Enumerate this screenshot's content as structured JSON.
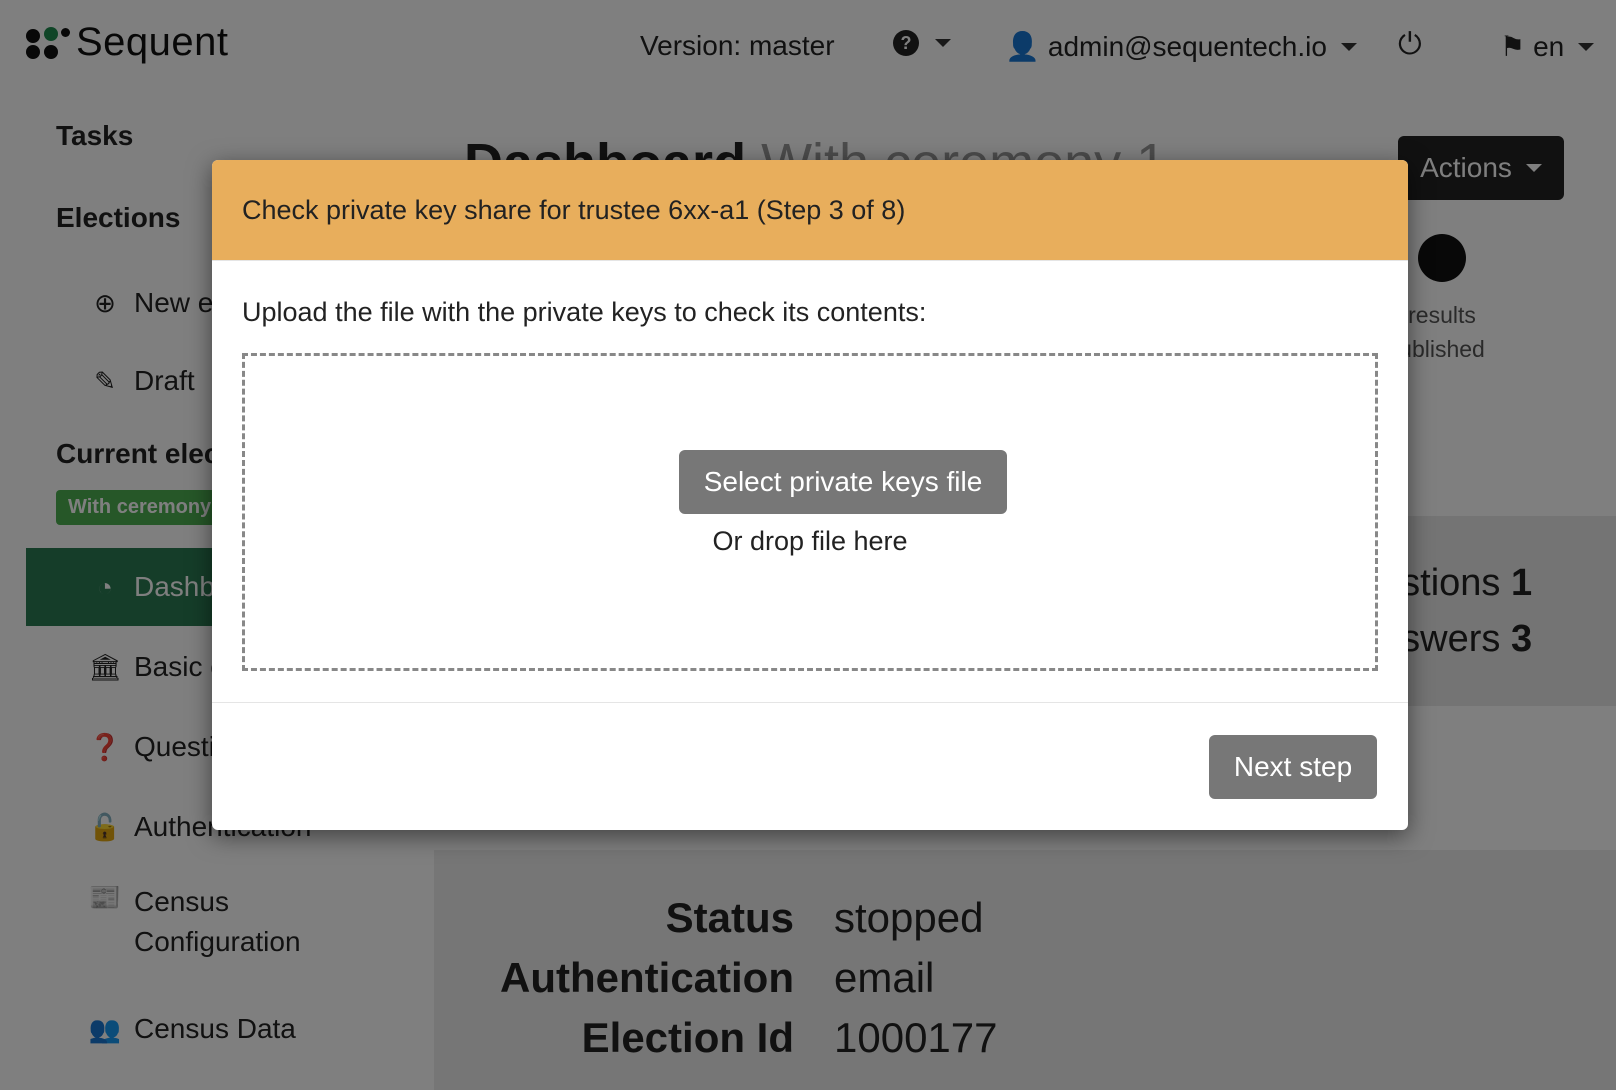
{
  "brand": {
    "name": "Sequent"
  },
  "topbar": {
    "version_text": "Version: master",
    "user_email": "admin@sequentech.io",
    "language": "en"
  },
  "sidebar": {
    "tasks_heading": "Tasks",
    "elections_heading": "Elections",
    "new_election": "New el",
    "draft": "Draft",
    "current_heading": "Current elec",
    "current_badge": "With ceremony",
    "items": [
      {
        "label": "Dashb",
        "icon": "dashboard-icon"
      },
      {
        "label": "Basic c",
        "icon": "bank-icon"
      },
      {
        "label": "Questi",
        "icon": "question-icon"
      },
      {
        "label": "Authentication",
        "icon": "unlock-icon"
      },
      {
        "label": "Census Configuration",
        "icon": "newspaper-icon"
      },
      {
        "label": "Census Data",
        "icon": "users-icon"
      }
    ]
  },
  "main": {
    "title": "Dashboard",
    "title_muted": "With ceremony 1",
    "actions_label": "Actions",
    "step_label_1": "results",
    "step_label_2": "ublished",
    "stats": {
      "questions_label": "estions",
      "questions_value": "1",
      "answers_label": "nswers",
      "answers_value": "3"
    },
    "info": [
      {
        "key": "Status",
        "value": "stopped"
      },
      {
        "key": "Authentication",
        "value": "email"
      },
      {
        "key": "Election Id",
        "value": "1000177"
      }
    ]
  },
  "modal": {
    "title": "Check private key share for trustee 6xx-a1 (Step 3 of 8)",
    "intro": "Upload the file with the private keys to check its contents:",
    "select_button": "Select private keys file",
    "drop_hint": "Or drop file here",
    "next_button": "Next step",
    "header_color": "#e8ae5c"
  }
}
